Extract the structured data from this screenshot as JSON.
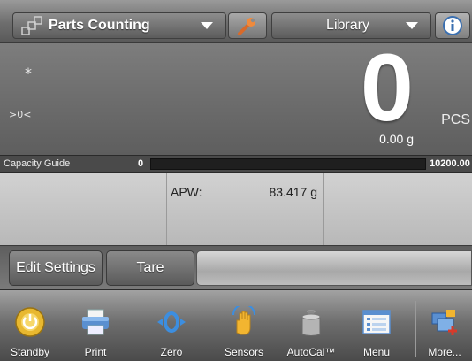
{
  "header": {
    "app_label": "Parts Counting",
    "library_label": "Library"
  },
  "display": {
    "stable_indicator": "*",
    "center_zero_indicator": ">0<",
    "value": "0",
    "unit": "PCS",
    "secondary_value": "0.00 g"
  },
  "capacity_guide": {
    "label": "Capacity Guide",
    "min": "0",
    "max": "10200.00",
    "fill_fraction": 0.0,
    "fill_color": "#6fc34a"
  },
  "fields": {
    "apw_label": "APW:",
    "apw_value": "83.417 g"
  },
  "actions": {
    "edit_settings": "Edit Settings",
    "tare": "Tare"
  },
  "toolbar": {
    "items": [
      {
        "label": "Standby",
        "icon": "standby-icon"
      },
      {
        "label": "Print",
        "icon": "printer-icon"
      },
      {
        "label": "Zero",
        "icon": "zero-icon"
      },
      {
        "label": "Sensors",
        "icon": "hand-sensor-icon"
      },
      {
        "label": "AutoCal™",
        "icon": "calibration-weight-icon"
      },
      {
        "label": "Menu",
        "icon": "menu-icon"
      },
      {
        "label": "More...",
        "icon": "more-icon"
      }
    ]
  }
}
